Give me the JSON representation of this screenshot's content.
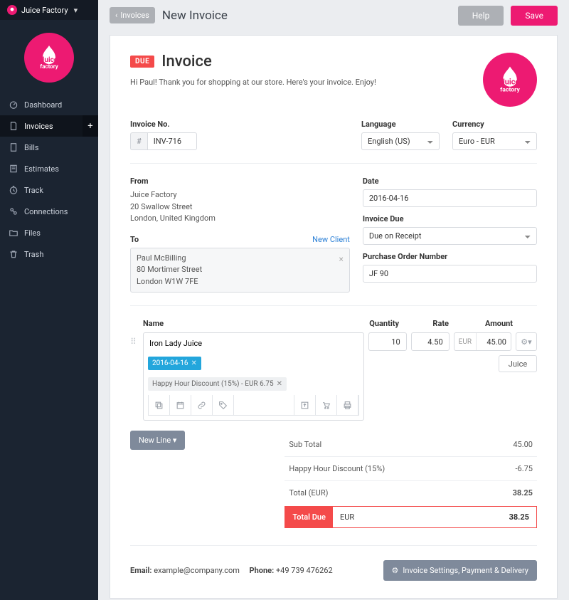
{
  "brand": {
    "name": "Juice Factory"
  },
  "sidebar": {
    "items": [
      {
        "label": "Dashboard",
        "icon": "gauge-icon"
      },
      {
        "label": "Invoices",
        "icon": "file-icon",
        "active": true,
        "add": true
      },
      {
        "label": "Bills",
        "icon": "page-icon"
      },
      {
        "label": "Estimates",
        "icon": "sheet-icon"
      },
      {
        "label": "Track",
        "icon": "clock-icon"
      },
      {
        "label": "Connections",
        "icon": "link-icon"
      },
      {
        "label": "Files",
        "icon": "folder-icon"
      },
      {
        "label": "Trash",
        "icon": "trash-icon"
      }
    ]
  },
  "topbar": {
    "back": "Invoices",
    "title": "New Invoice",
    "help": "Help",
    "save": "Save"
  },
  "invoice": {
    "badge": "DUE",
    "heading": "Invoice",
    "greeting": "Hi Paul! Thank you for shopping at our store. Here's your invoice. Enjoy!",
    "number_label": "Invoice No.",
    "number_prefix": "#",
    "number": "INV-716",
    "language_label": "Language",
    "language": "English (US)",
    "currency_label": "Currency",
    "currency": "Euro - EUR",
    "from_label": "From",
    "from_name": "Juice Factory",
    "from_line1": "20 Swallow Street",
    "from_line2": "London, United Kingdom",
    "to_label": "To",
    "new_client": "New Client",
    "to_name": "Paul McBilling",
    "to_line1": "80 Mortimer Street",
    "to_line2": "London W1W 7FE",
    "date_label": "Date",
    "date": "2016-04-16",
    "due_label": "Invoice Due",
    "due_value": "Due on Receipt",
    "po_label": "Purchase Order Number",
    "po_value": "JF 90",
    "col_name": "Name",
    "col_qty": "Quantity",
    "col_rate": "Rate",
    "col_amount": "Amount",
    "line": {
      "name": "Iron Lady Juice",
      "qty": "10",
      "rate": "4.50",
      "currency": "EUR",
      "amount": "45.00",
      "unit": "Juice",
      "chip_date": "2016-04-16",
      "chip_disc": "Happy Hour Discount (15%) - EUR 6.75"
    },
    "new_line": "New Line",
    "totals": {
      "sub_l": "Sub Total",
      "sub_v": "45.00",
      "disc_l": "Happy Hour Discount (15%)",
      "disc_v": "-6.75",
      "tot_l": "Total (EUR)",
      "tot_v": "38.25",
      "due_l": "Total Due",
      "due_c": "EUR",
      "due_v": "38.25"
    },
    "email_l": "Email:",
    "email_v": "example@company.com",
    "phone_l": "Phone:",
    "phone_v": "+49 739 476262",
    "settings": "Invoice Settings, Payment & Delivery"
  }
}
